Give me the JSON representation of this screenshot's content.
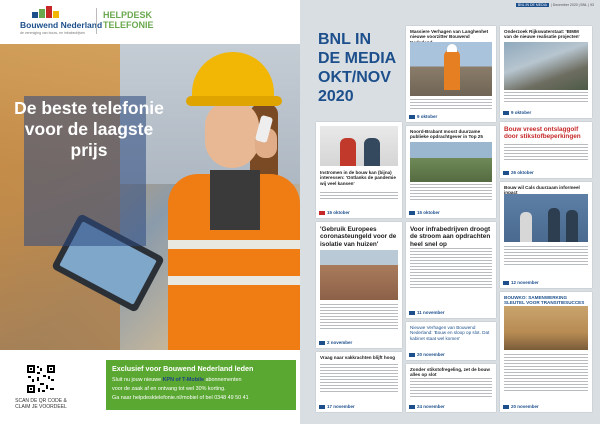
{
  "header": {
    "logo_name": "Bouwend Nederland",
    "logo_tagline": "de vereniging van bouw- en infrabedrijven",
    "section_title_1": "HELPDESK",
    "section_title_2": "TELEFONIE"
  },
  "hero": {
    "tagline": "De beste telefonie voor de laagste prijs"
  },
  "promo": {
    "title": "Exclusief voor Bouwend Nederland leden",
    "line1_pre": "Sluit nu jouw nieuwe ",
    "line1_em": "KPN of T-Mobile",
    "line1_post": " abonnementen",
    "line2": "voor de zaak af en ontvang tot wel 30% korting.",
    "line3": "Ga naar helpdesktelefonie.nl/mobiel of bel 0348 49 50 41"
  },
  "qr": {
    "label_1": "SCAN DE QR CODE &",
    "label_2": "CLAIM JE VOORDEEL"
  },
  "right_page": {
    "meta_tag": "BNL IN DE MEDIA",
    "meta_text": "| December 2020 | BNL | 93",
    "heading_1": "BNL IN",
    "heading_2": "DE MEDIA",
    "heading_3": "OKT/NOV",
    "heading_4": "2020"
  },
  "articles": [
    {
      "title": "Massiere Verhagen van Langhenhet nieuwe voorzitter Bouwend Nederland",
      "date": "9 oktober"
    },
    {
      "title": "Onderzoek Rijkswaterstaat: 'BIMM van de nieuwe realisatie projecten'",
      "date": "9 oktober"
    },
    {
      "title": "Instromen in de bouw kan (bijna) interessen: 'Ontlanks de pandemie wij veel kansen'",
      "date": "15 oktober"
    },
    {
      "title": "Noord-Brabant mosst duurzame publieke opdrachtgever in Top 25",
      "date": "15 oktober"
    },
    {
      "title": "Bouw vreest ontslaggolf door stikstofbeperkingen",
      "date": "26 oktober"
    },
    {
      "title": "'Gebruik Europees coronasteungeld voor de isolatie van huizen'",
      "date": "2 november"
    },
    {
      "title": "Voor infrabedrijven droogt de stroom aan opdrachten heel snel op",
      "date": "11 november"
    },
    {
      "title": "Bouw wil Cals duurzaam informeel inpact",
      "date": "12 november"
    },
    {
      "title": "Nieuwe Verhagen van Bouwend Nederland: 'Bouw en sloop op slot. Dat kabinet staat wel komen'",
      "date": "20 november"
    },
    {
      "title": "Vraag naar vakkrachten blijft hoog",
      "date": "17 november"
    },
    {
      "title": "Zonder stikstofregeling, zet de bouw alles op slot",
      "date": "24 november"
    },
    {
      "title": "BOUWKO: SAMENWERKING SLEUTEL VOOR TRANSITIESUCCES",
      "date": "20 november"
    }
  ]
}
